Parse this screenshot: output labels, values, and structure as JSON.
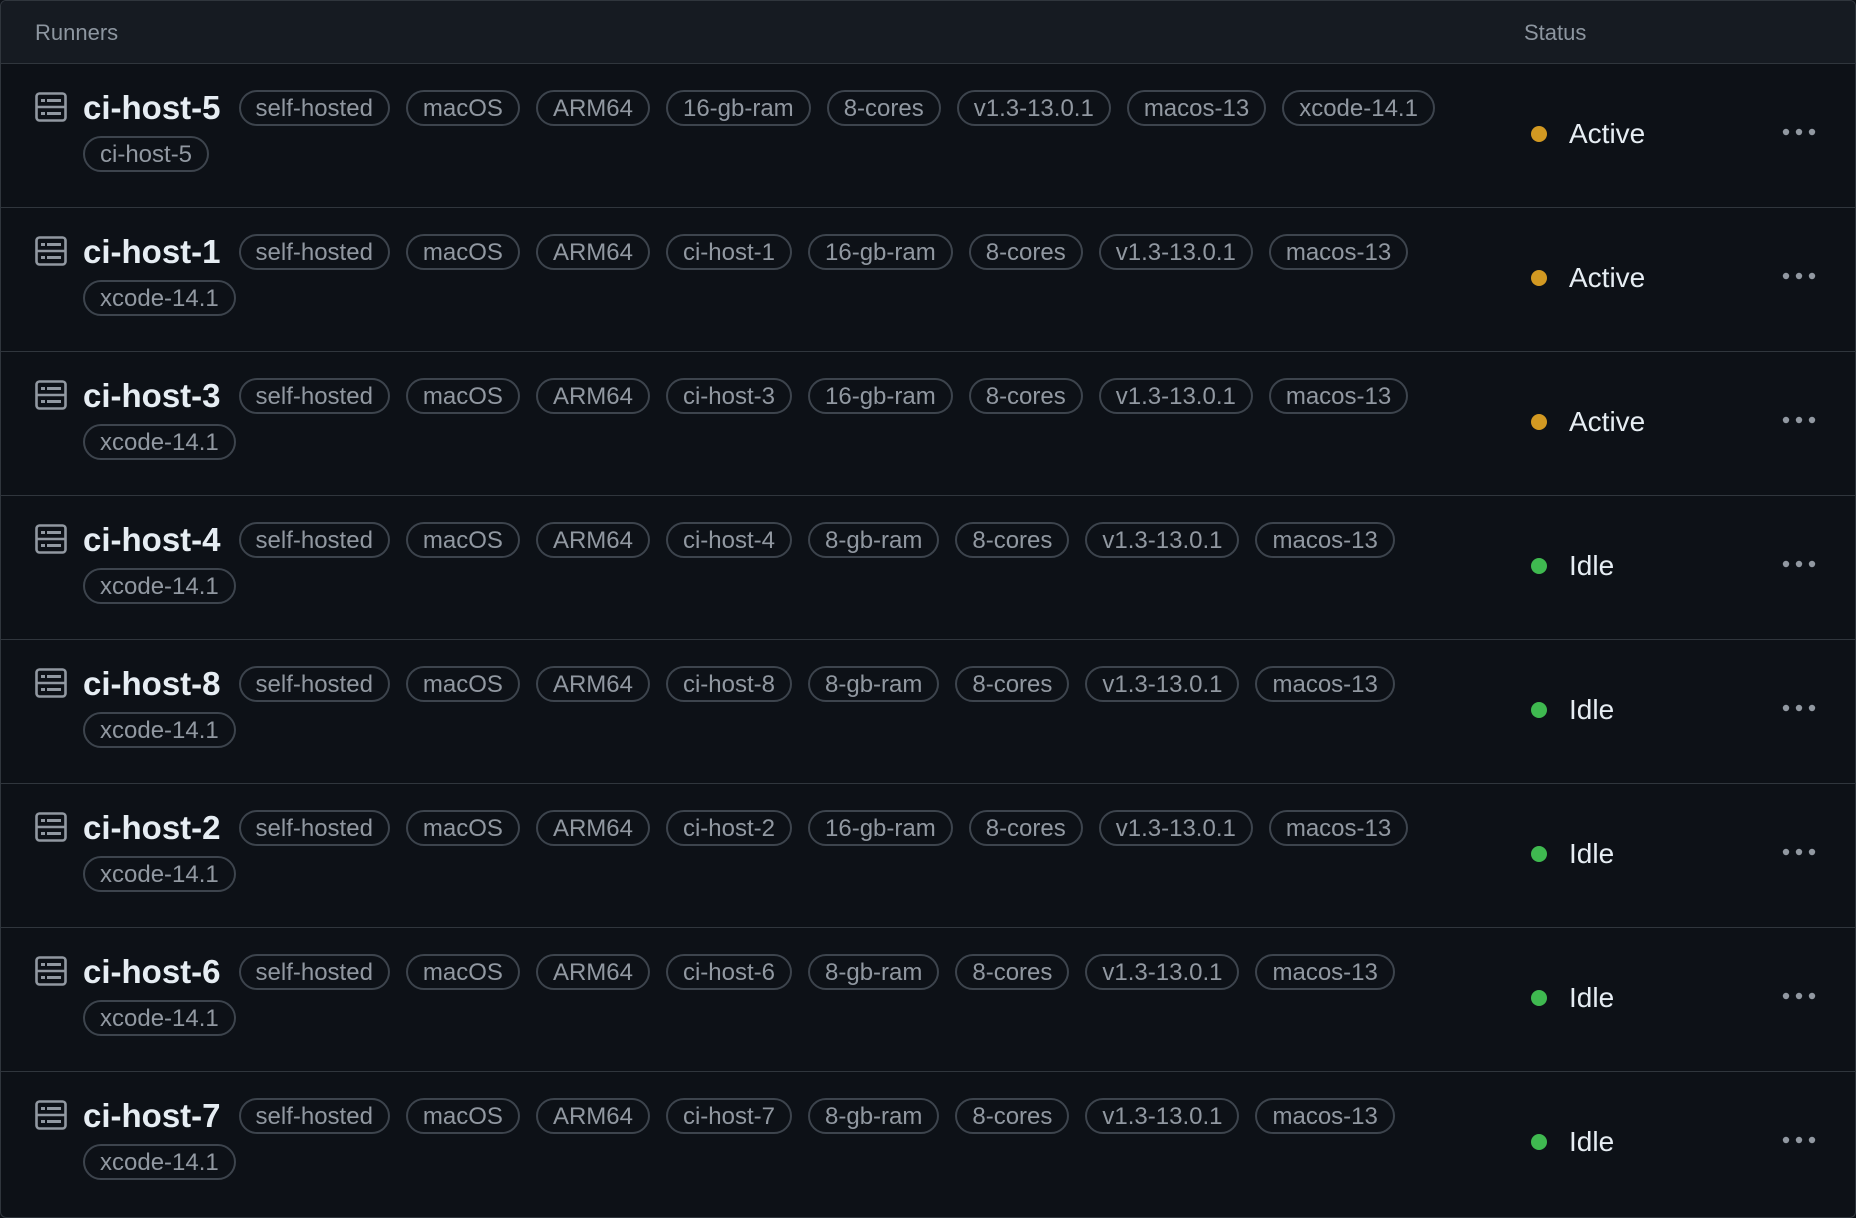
{
  "header": {
    "runners_label": "Runners",
    "status_label": "Status"
  },
  "colors": {
    "active": "#d29922",
    "idle": "#3fb950"
  },
  "runners": [
    {
      "name": "ci-host-5",
      "labels": [
        "self-hosted",
        "macOS",
        "ARM64",
        "16-gb-ram",
        "8-cores",
        "v1.3-13.0.1",
        "macos-13",
        "xcode-14.1",
        "ci-host-5"
      ],
      "status": "Active",
      "status_kind": "active"
    },
    {
      "name": "ci-host-1",
      "labels": [
        "self-hosted",
        "macOS",
        "ARM64",
        "ci-host-1",
        "16-gb-ram",
        "8-cores",
        "v1.3-13.0.1",
        "macos-13",
        "xcode-14.1"
      ],
      "status": "Active",
      "status_kind": "active"
    },
    {
      "name": "ci-host-3",
      "labels": [
        "self-hosted",
        "macOS",
        "ARM64",
        "ci-host-3",
        "16-gb-ram",
        "8-cores",
        "v1.3-13.0.1",
        "macos-13",
        "xcode-14.1"
      ],
      "status": "Active",
      "status_kind": "active"
    },
    {
      "name": "ci-host-4",
      "labels": [
        "self-hosted",
        "macOS",
        "ARM64",
        "ci-host-4",
        "8-gb-ram",
        "8-cores",
        "v1.3-13.0.1",
        "macos-13",
        "xcode-14.1"
      ],
      "status": "Idle",
      "status_kind": "idle"
    },
    {
      "name": "ci-host-8",
      "labels": [
        "self-hosted",
        "macOS",
        "ARM64",
        "ci-host-8",
        "8-gb-ram",
        "8-cores",
        "v1.3-13.0.1",
        "macos-13",
        "xcode-14.1"
      ],
      "status": "Idle",
      "status_kind": "idle"
    },
    {
      "name": "ci-host-2",
      "labels": [
        "self-hosted",
        "macOS",
        "ARM64",
        "ci-host-2",
        "16-gb-ram",
        "8-cores",
        "v1.3-13.0.1",
        "macos-13",
        "xcode-14.1"
      ],
      "status": "Idle",
      "status_kind": "idle"
    },
    {
      "name": "ci-host-6",
      "labels": [
        "self-hosted",
        "macOS",
        "ARM64",
        "ci-host-6",
        "8-gb-ram",
        "8-cores",
        "v1.3-13.0.1",
        "macos-13",
        "xcode-14.1"
      ],
      "status": "Idle",
      "status_kind": "idle"
    },
    {
      "name": "ci-host-7",
      "labels": [
        "self-hosted",
        "macOS",
        "ARM64",
        "ci-host-7",
        "8-gb-ram",
        "8-cores",
        "v1.3-13.0.1",
        "macos-13",
        "xcode-14.1"
      ],
      "status": "Idle",
      "status_kind": "idle"
    }
  ],
  "icons": {
    "runner": "server-icon",
    "menu": "kebab-horizontal-icon"
  }
}
